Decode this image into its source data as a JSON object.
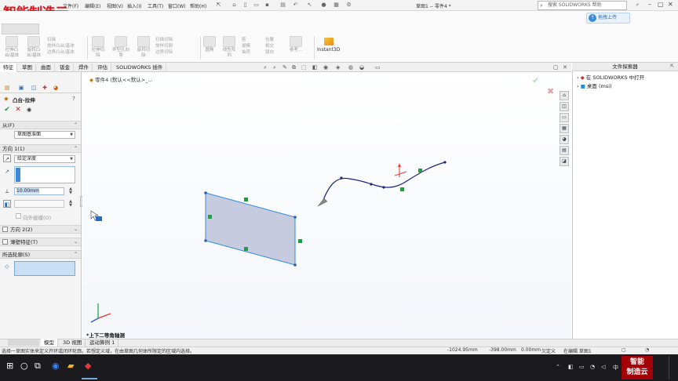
{
  "watermark": {
    "text": "智能制造云"
  },
  "menu": [
    "文件(F)",
    "编辑(E)",
    "视图(V)",
    "插入(I)",
    "工具(T)",
    "窗口(W)",
    "帮助(H)"
  ],
  "doc_title": "草图1 -- 零件4 *",
  "search": {
    "placeholder": "搜索 SOLIDWORKS 帮助"
  },
  "upload_label": "拖拽上传",
  "ribbon": {
    "tools": [
      {
        "label": "拉伸凸\n台/基体"
      },
      {
        "label": "旋转凸\n台/基体"
      },
      {
        "label": "扫描"
      },
      {
        "label": "拉伸切\n除"
      },
      {
        "label": "异型孔向\n导"
      },
      {
        "label": "旋转切\n除"
      },
      {
        "label": "圆角"
      },
      {
        "label": "线性阵\n列"
      },
      {
        "label": "参考..."
      }
    ],
    "small_items": [
      "放样凸台/基体",
      "边界凸台/基体",
      "扫描切除",
      "放样切割",
      "边界切除",
      "筋",
      "拔模",
      "抽壳",
      "包覆",
      "相交",
      "镜向"
    ],
    "instant3d": "Instant3D"
  },
  "tabs": [
    "特征",
    "草图",
    "曲面",
    "钣金",
    "焊件",
    "评估",
    "SOLIDWORKS 插件"
  ],
  "active_tab": 0,
  "breadcrumb": "零件4  (默认<<默认>_...",
  "property_manager": {
    "title": "凸台-拉伸",
    "from_label": "从(F)",
    "from_value": "草图基准面",
    "direction1_label": "方向 1(1)",
    "end_condition": "给定深度",
    "depth_value": "10.00mm",
    "draft_outward": "向外拔模(O)",
    "direction2_label": "方向 2(2)",
    "thin_feature_label": "薄壁特征(T)",
    "selected_contours_label": "所选轮廓(S)"
  },
  "view_label": "*上下二等角轴测",
  "file_explorer": {
    "title": "文件探索器",
    "items": [
      "在 SOLIDWORKS 中打开",
      "桌面 (msi)"
    ]
  },
  "bottom_tabs": [
    "模型",
    "3D 视图",
    "运动算例 1"
  ],
  "status": {
    "message": "选择一草图实体来定义开环或闭环轮廓。若想定义域，在由草图几何体所限定的区域内选择。",
    "x": "-1024.95mm",
    "y": "-398.00mm",
    "z": "0.00mm",
    "state": "欠定义",
    "editing": "在编辑 草图1"
  },
  "tray": {
    "ime": "中"
  },
  "corner_logo": [
    "智能",
    "制造云"
  ],
  "colors": {
    "accent": "#2a6cb4",
    "sketch_blue": "#1f5fbf",
    "sketch_fill": "#c7cbe0",
    "relation_green": "#1aa33c",
    "watermark": "#e0141e"
  }
}
